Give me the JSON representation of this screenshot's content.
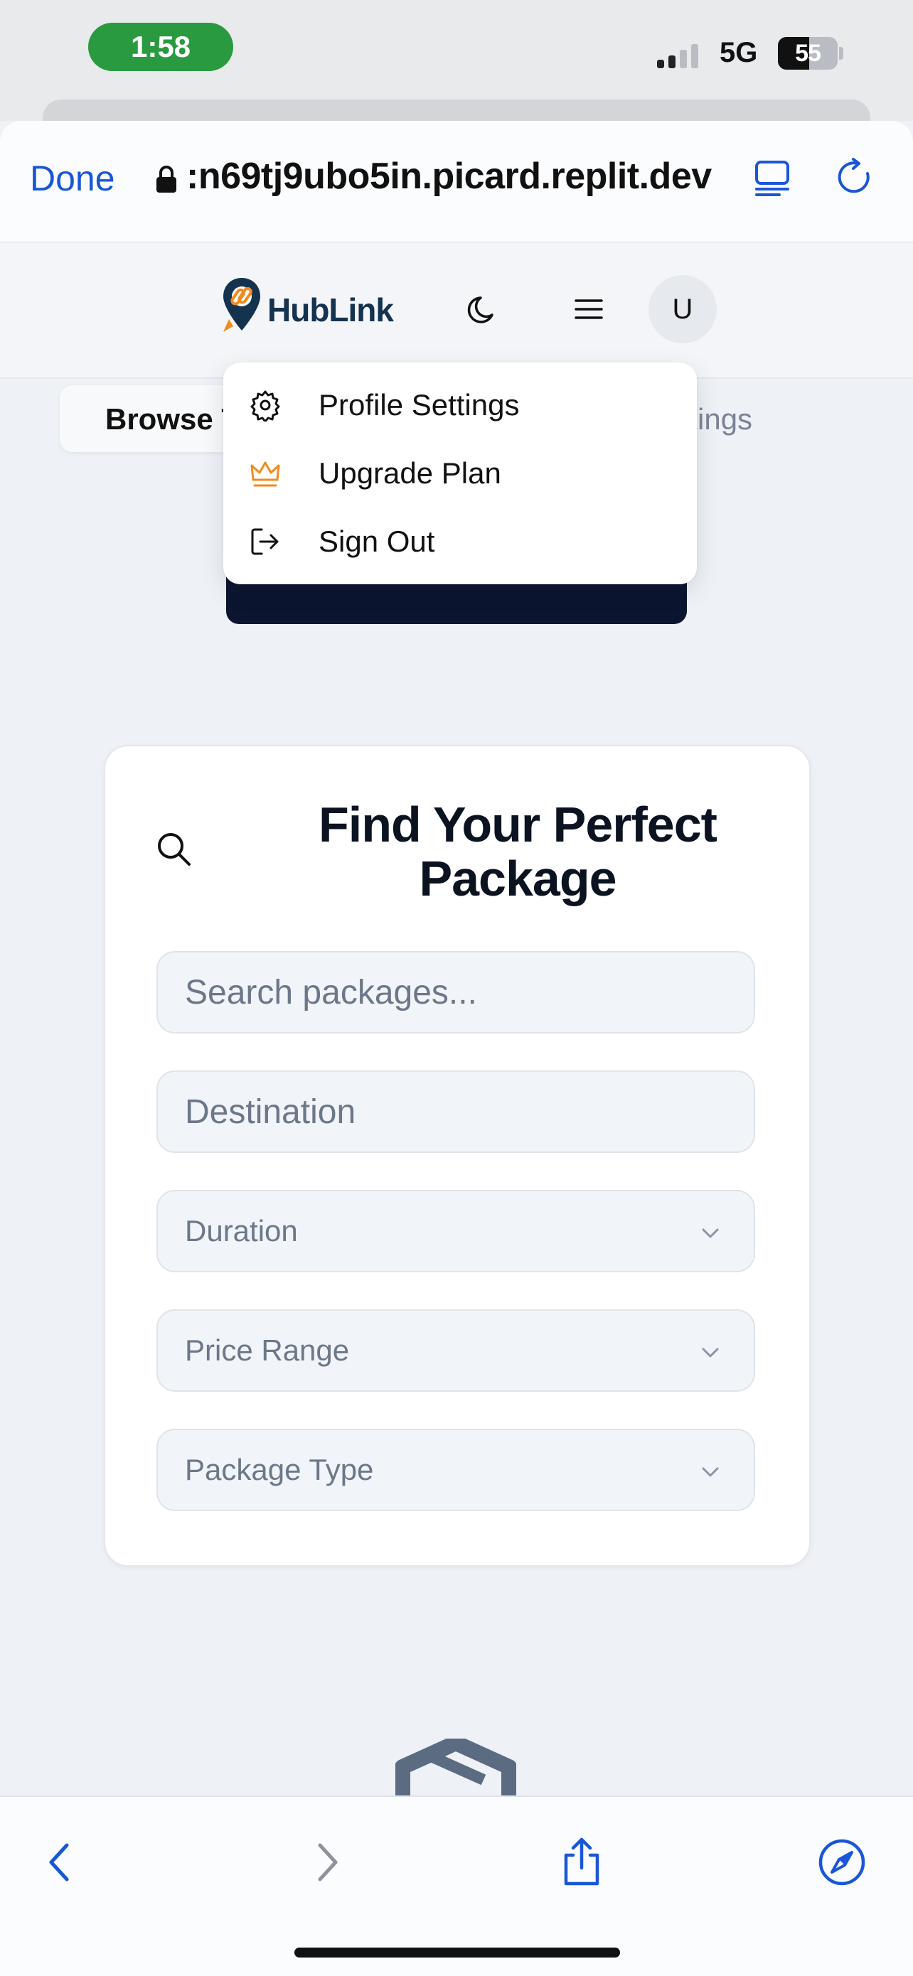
{
  "status_bar": {
    "time": "1:58",
    "network": "5G",
    "battery": "55"
  },
  "safari": {
    "done_label": "Done",
    "url": ":n69tj9ubo5in.picard.replit.dev"
  },
  "header": {
    "logo_text": "HubLink",
    "avatar_initial": "U"
  },
  "tabs": {
    "browse_label": "Browse T",
    "bookings_label": "kings"
  },
  "dropdown": {
    "items": [
      {
        "label": "Profile Settings",
        "icon": "gear-icon"
      },
      {
        "label": "Upgrade Plan",
        "icon": "crown-icon"
      },
      {
        "label": "Sign Out",
        "icon": "sign-out-icon"
      }
    ]
  },
  "search_card": {
    "title": "Find Your Perfect Package",
    "search_placeholder": "Search packages...",
    "destination_placeholder": "Destination",
    "duration_label": "Duration",
    "price_label": "Price Range",
    "type_label": "Package Type"
  },
  "colors": {
    "accent_blue": "#1a56d6",
    "brand_orange": "#f28a1e",
    "brand_navy": "#15324f",
    "status_green": "#2a9a41"
  }
}
